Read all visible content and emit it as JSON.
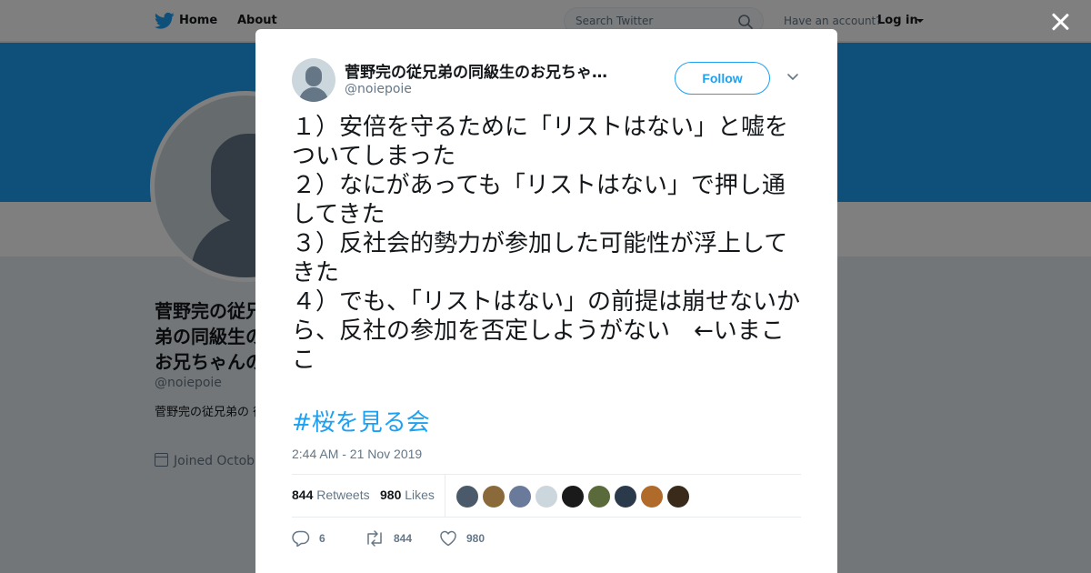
{
  "topnav": {
    "home_label": "Home",
    "about_label": "About",
    "search_placeholder": "Search Twitter",
    "have_account": "Have an account?",
    "login_label": "Log in"
  },
  "profile": {
    "name": "菅野完の従兄弟の同級生のお兄ちゃんの友達",
    "handle": "@noiepoie",
    "bio": "菅野完の従兄弟の 彼女の先輩の友達",
    "joined": "Joined Octobe"
  },
  "tweet": {
    "author_name": "菅野完の従兄弟の同級生のお兄ちゃ…",
    "author_handle": "@noiepoie",
    "follow_label": "Follow",
    "text": "１）安倍を守るために「リストはない」と嘘をついてしまった\n２）なにがあっても「リストはない」で押し通してきた\n３）反社会的勢力が参加した可能性が浮上してきた\n４）でも、「リストはない」の前提は崩せないから、反社の参加を否定しようがない　←いまここ",
    "hashtag": "#桜を見る会",
    "timestamp": "2:44 AM - 21 Nov 2019",
    "retweets_count": "844",
    "retweets_label": "Retweets",
    "likes_count": "980",
    "likes_label": "Likes",
    "reply_count": "6",
    "retweet_action_count": "844",
    "like_action_count": "980"
  },
  "likers": [
    {
      "color": "#4a5a6a"
    },
    {
      "color": "#8a6a3a"
    },
    {
      "color": "#6a7a9a"
    },
    {
      "color": "#ccd6dd"
    },
    {
      "color": "#1a1a1a"
    },
    {
      "color": "#5a6a3a"
    },
    {
      "color": "#2a3a4a"
    },
    {
      "color": "#b06a2a"
    },
    {
      "color": "#3a2a1a"
    }
  ],
  "colors": {
    "accent": "#1da1f2",
    "text": "#14171a",
    "muted": "#657786"
  }
}
